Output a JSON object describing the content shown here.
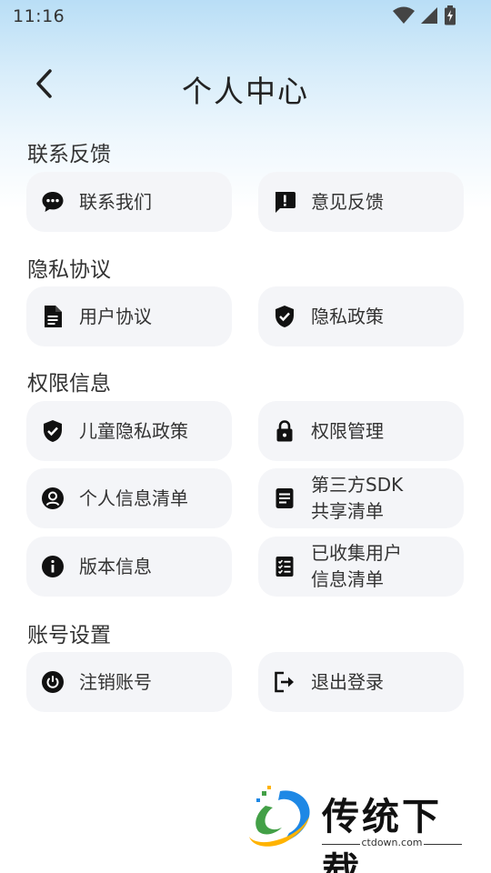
{
  "status": {
    "time": "11:16"
  },
  "header": {
    "title": "个人中心"
  },
  "sections": {
    "contact": {
      "title": "联系反馈",
      "items": [
        "联系我们",
        "意见反馈"
      ]
    },
    "privacy": {
      "title": "隐私协议",
      "items": [
        "用户协议",
        "隐私政策"
      ]
    },
    "permissions": {
      "title": "权限信息",
      "items": [
        "儿童隐私政策",
        "权限管理",
        "个人信息清单",
        "第三方SDK",
        "共享清单",
        "版本信息",
        "已收集用户",
        "信息清单"
      ]
    },
    "account": {
      "title": "账号设置",
      "items": [
        "注销账号",
        "退出登录"
      ]
    }
  },
  "watermark": {
    "brand": "传统下载",
    "url": "ctdown.com"
  },
  "icons": [
    "wifi-icon",
    "signal-icon",
    "battery-icon",
    "back-arrow-icon",
    "chat-icon",
    "feedback-icon",
    "document-icon",
    "shield-check-icon",
    "lock-icon",
    "person-icon",
    "notes-icon",
    "info-icon",
    "checklist-icon",
    "power-icon",
    "logout-icon"
  ]
}
